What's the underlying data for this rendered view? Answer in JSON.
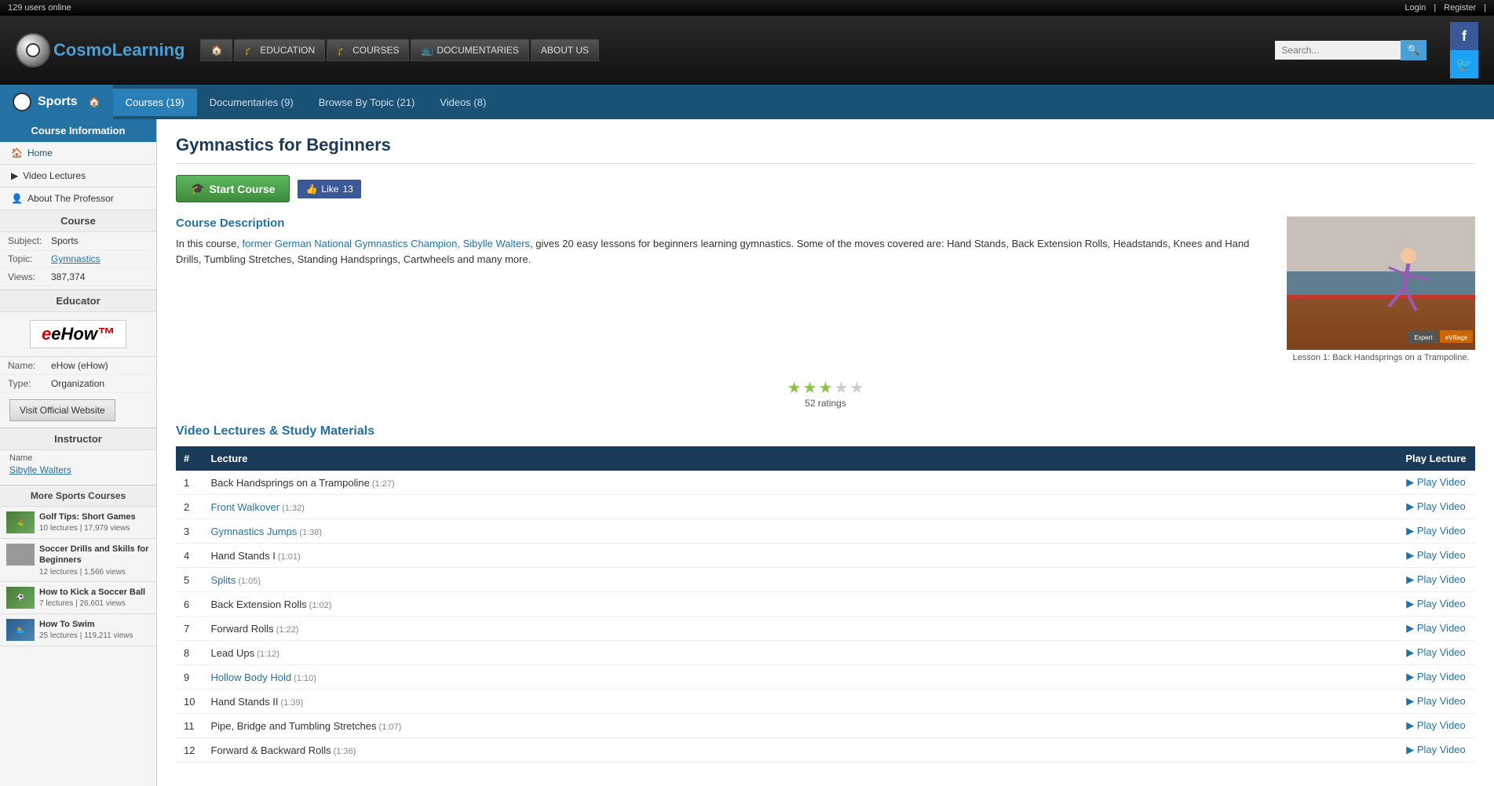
{
  "topbar": {
    "users_online": "129 users online",
    "login": "Login",
    "register": "Register"
  },
  "header": {
    "logo_text_cosmo": "Cosmo",
    "logo_text_learning": "Learning",
    "nav": {
      "home": "Home",
      "education": "EDUCATION",
      "courses": "COURSES",
      "documentaries": "DOCUMENTARIES",
      "about_us": "ABOUT US",
      "search_placeholder": "Search..."
    }
  },
  "sports_nav": {
    "title": "Sports",
    "courses": "Courses (19)",
    "documentaries": "Documentaries (9)",
    "browse_by_topic": "Browse By Topic (21)",
    "videos": "Videos (8)"
  },
  "sidebar": {
    "course_info_title": "Course Information",
    "home": "Home",
    "video_lectures": "Video Lectures",
    "about_professor": "About The Professor",
    "course_title": "Course",
    "subject_label": "Subject:",
    "subject_value": "Sports",
    "topic_label": "Topic:",
    "topic_value": "Gymnastics",
    "views_label": "Views:",
    "views_value": "387,374",
    "educator_title": "Educator",
    "ehow_logo": "eHow",
    "name_label": "Name:",
    "name_value": "eHow (eHow)",
    "type_label": "Type:",
    "type_value": "Organization",
    "visit_btn": "Visit Official Website",
    "instructor_title": "Instructor",
    "instructor_name_label": "Name",
    "instructor_name_value": "Sibylle Walters",
    "more_courses_title": "More Sports Courses",
    "more_courses": [
      {
        "title": "Golf Tips: Short Games",
        "meta": "10 lectures  |  17,979 views",
        "thumb_color": "green"
      },
      {
        "title": "Soccer Drills and Skills for Beginners",
        "meta": "12 lectures  |  1,566 views",
        "thumb_color": "gray"
      },
      {
        "title": "How to Kick a Soccer Ball",
        "meta": "7 lectures  |  26,601 views",
        "thumb_color": "green"
      },
      {
        "title": "How To Swim",
        "meta": "25 lectures  |  119,211 views",
        "thumb_color": "blue"
      }
    ]
  },
  "main": {
    "course_title": "Gymnastics for Beginners",
    "start_course_label": "Start Course",
    "like_label": "Like",
    "like_count": "13",
    "desc_title": "Course Description",
    "desc_body_1": "In this course, ",
    "desc_highlight": "former German National Gymnastics Champion, Sibylle Walters",
    "desc_body_2": ", gives 20 easy lessons for beginners learning gymnastics. Some of the moves covered are: Hand Stands, Back Extension Rolls, Headstands, Knees and Hand Drills, Tumbling Stretches, Standing Handsprings, Cartwheels and many more.",
    "image_caption": "Lesson 1: Back Handsprings on a Trampoline.",
    "badge_expert": "Expert",
    "badge_village": "eVillage",
    "rating_count": "52 ratings",
    "lectures_title": "Video Lectures & Study Materials",
    "table_headers": {
      "num": "#",
      "lecture": "Lecture",
      "play": "Play Lecture"
    },
    "lectures": [
      {
        "num": 1,
        "title": "Back Handsprings on a Trampoline",
        "duration": "(1:27)",
        "is_link": false
      },
      {
        "num": 2,
        "title": "Front Walkover",
        "duration": "(1:32)",
        "is_link": true
      },
      {
        "num": 3,
        "title": "Gymnastics Jumps",
        "duration": "(1:38)",
        "is_link": true
      },
      {
        "num": 4,
        "title": "Hand Stands I",
        "duration": "(1:01)",
        "is_link": false
      },
      {
        "num": 5,
        "title": "Splits",
        "duration": "(1:05)",
        "is_link": true
      },
      {
        "num": 6,
        "title": "Back Extension Rolls",
        "duration": "(1:02)",
        "is_link": false
      },
      {
        "num": 7,
        "title": "Forward Rolls",
        "duration": "(1:22)",
        "is_link": false
      },
      {
        "num": 8,
        "title": "Lead Ups",
        "duration": "(1:12)",
        "is_link": false
      },
      {
        "num": 9,
        "title": "Hollow Body Hold",
        "duration": "(1:10)",
        "is_link": true
      },
      {
        "num": 10,
        "title": "Hand Stands II",
        "duration": "(1:39)",
        "is_link": false
      },
      {
        "num": 11,
        "title": "Pipe, Bridge and Tumbling Stretches",
        "duration": "(1:07)",
        "is_link": false
      },
      {
        "num": 12,
        "title": "Forward & Backward Rolls",
        "duration": "(1:36)",
        "is_link": false
      }
    ],
    "play_video_label": "Play Video",
    "stars_filled": 3,
    "stars_total": 5
  }
}
